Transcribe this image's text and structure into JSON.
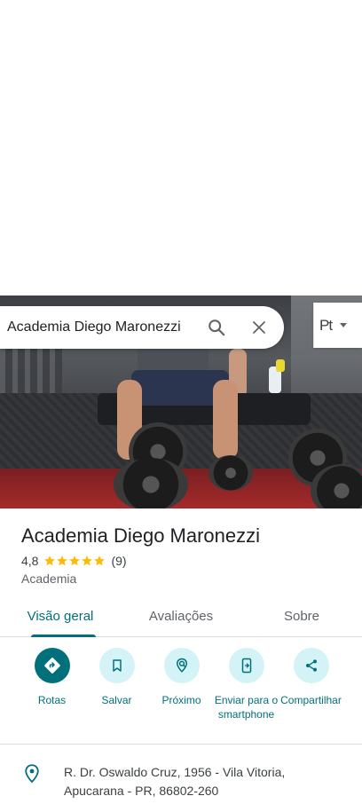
{
  "search": {
    "query": "Academia Diego Maronezzi"
  },
  "language": {
    "label": "Pt"
  },
  "place": {
    "name": "Academia Diego Maronezzi",
    "rating": "4,8",
    "stars": 5,
    "reviews_count": "(9)",
    "category": "Academia"
  },
  "tabs": [
    {
      "label": "Visão geral",
      "active": true
    },
    {
      "label": "Avaliações",
      "active": false
    },
    {
      "label": "Sobre",
      "active": false
    }
  ],
  "actions": [
    {
      "label": "Rotas",
      "icon": "directions-icon"
    },
    {
      "label": "Salvar",
      "icon": "bookmark-icon"
    },
    {
      "label": "Próximo",
      "icon": "nearby-icon"
    },
    {
      "label": "Enviar para o smartphone",
      "icon": "send-to-phone-icon"
    },
    {
      "label": "Compartilhar",
      "icon": "share-icon"
    }
  ],
  "address": {
    "line": "R. Dr. Oswaldo Cruz, 1956 - Vila Vitoria, Apucarana - PR, 86802-260"
  },
  "colors": {
    "accent": "#00707a",
    "accent_light": "#d3f3f6",
    "star": "#fbbc04"
  }
}
